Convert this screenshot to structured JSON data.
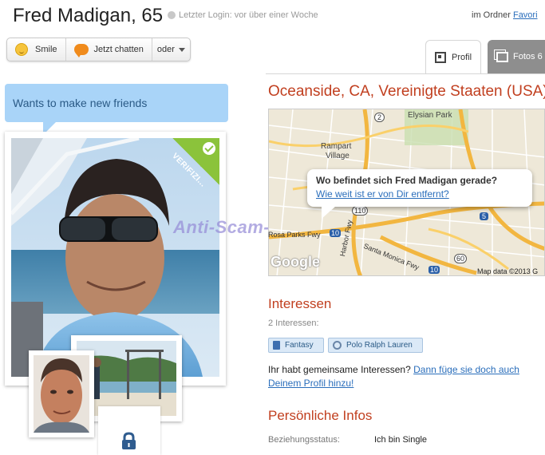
{
  "header": {
    "name_age": "Fred Madigan, 65",
    "last_login": "Letzter Login: vor über einer Woche",
    "folder_prefix": "im Ordner",
    "folder_link": "Favori"
  },
  "actions": {
    "smile": "Smile",
    "chat": "Jetzt chatten",
    "more": "oder"
  },
  "tabs": {
    "profile": "Profil",
    "photos": "Fotos 6"
  },
  "status": {
    "text": "Wants to make new friends"
  },
  "photo": {
    "verified_badge": "VERIFIZI..."
  },
  "watermark": "Anti-Scam-Forum.NL",
  "location": {
    "title": "Oceanside, CA, Vereinigte Staaten (USA)",
    "map": {
      "popup_question": "Wo befindet sich Fred Madigan gerade?",
      "popup_link": "Wie weit ist er von Dir entfernt?",
      "credit": "Map data ©2013 G",
      "logo": "Google",
      "labels": {
        "elysian_park": "Elysian Park",
        "rampart": "Rampart",
        "village": "Village",
        "rosa_parks": "Rosa Parks Fwy",
        "harbor": "Harbor Fwy",
        "santa_monica": "Santa Monica Fwy",
        "shield_2": "2",
        "shield_110": "110",
        "shield_10": "10",
        "shield_10b": "10",
        "shield_5": "5",
        "shield_60": "60"
      }
    }
  },
  "interests": {
    "title": "Interessen",
    "count": "2 Interessen:",
    "items": [
      "Fantasy",
      "Polo Ralph Lauren"
    ],
    "common_text": "Ihr habt gemeinsame Interessen?",
    "common_link": "Dann füge sie doch auch Deinem Profil hinzu!"
  },
  "personal": {
    "title": "Persönliche Infos",
    "relationship_label": "Beziehungsstatus:",
    "relationship_value": "Ich bin Single"
  },
  "colors": {
    "section_title": "#c13f1f",
    "link": "#2a6ebb",
    "status_bubble": "#a9d4f8",
    "verified": "#8bc33b"
  }
}
